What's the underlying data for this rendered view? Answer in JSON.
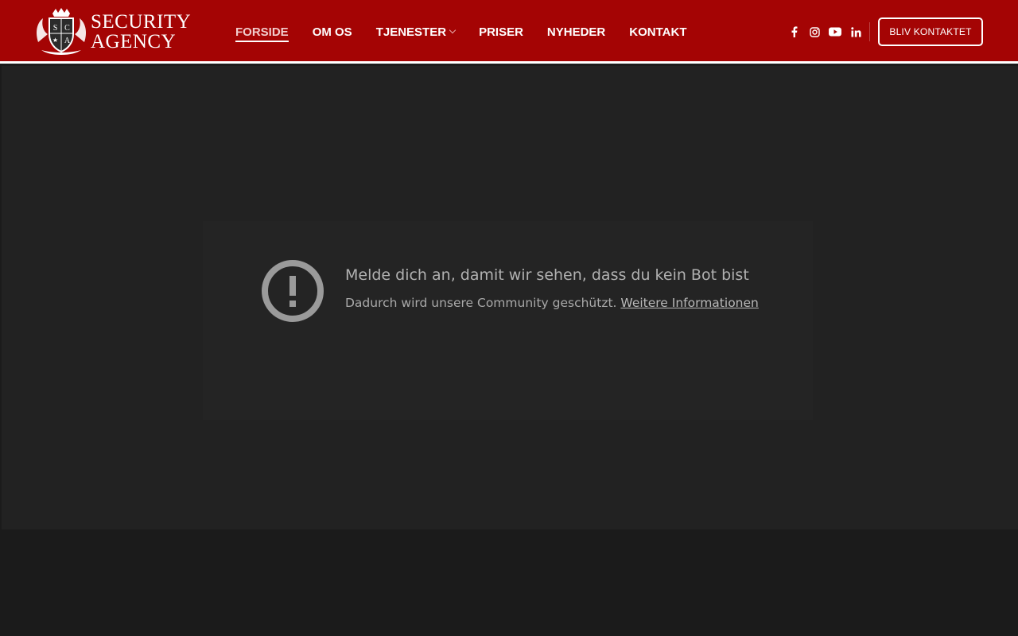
{
  "logo": {
    "line1": "SECURITY",
    "line2": "AGENCY",
    "crest_letters": [
      "S",
      "C",
      "A"
    ],
    "icon": "crest-logo-icon"
  },
  "nav": {
    "items": [
      {
        "label": "FORSIDE",
        "active": true
      },
      {
        "label": "OM OS"
      },
      {
        "label": "TJENESTER",
        "has_dropdown": true
      },
      {
        "label": "PRISER"
      },
      {
        "label": "NYHEDER"
      },
      {
        "label": "KONTAKT"
      }
    ]
  },
  "social": [
    "facebook-icon",
    "instagram-icon",
    "youtube-icon",
    "linkedin-icon"
  ],
  "cta_label": "BLIV KONTAKTET",
  "embed": {
    "title": "Melde dich an, damit wir sehen, dass du kein Bot bist",
    "subtitle": "Dadurch wird unsere Community geschützt.",
    "link": "Weitere Informationen",
    "icon": "alert-circle-icon"
  },
  "colors": {
    "header_bg": "#a40404",
    "hero_bg": "#222222",
    "page_bg": "#1b1b1b",
    "text_muted": "#b1b1b1"
  }
}
